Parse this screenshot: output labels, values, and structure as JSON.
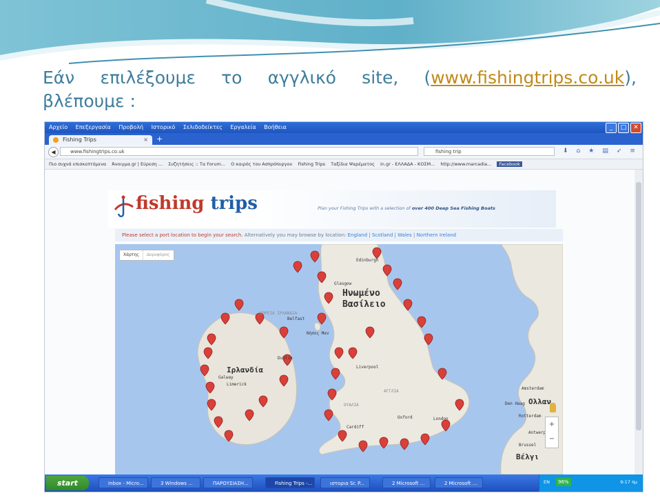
{
  "slide": {
    "heading_line1_a": "Εάν",
    "heading_line1_b": "επιλέξουμε",
    "heading_line1_c": "το",
    "heading_line1_d": "αγγλικό",
    "heading_line1_e": "site,",
    "heading_link": "www.fishingtrips.co.uk",
    "heading_line2": "βλέπουμε :",
    "accent_color": "#3e7d9b"
  },
  "browser": {
    "menu": [
      "Αρχείο",
      "Επεξεργασία",
      "Προβολή",
      "Ιστορικό",
      "Σελιδοδείκτες",
      "Εργαλεία",
      "Βοήθεια"
    ],
    "tab_title": "Fishing Trips",
    "url": "www.fishingtrips.co.uk",
    "search_value": "fishing trip",
    "bookmarks": [
      "Πιο συχνά επισκεπτόμενα",
      "Άνοιγμα.gr | Εύρεση ...",
      "Συζητήσεις :: Τα Forum...",
      "Ο καιρός του Ασπρόπυργου",
      "Fishing Trips",
      "Ταξίδια Ψαρέματος",
      "in.gr - ΕΛΛΑΔΑ - ΚΟΣΜ...",
      "http://www.marcadia...",
      "Facebook"
    ]
  },
  "site": {
    "logo_part1": "fishing",
    "logo_part2": "trips",
    "tagline_start": "Plan your Fishing Trips with a selection of",
    "tagline_bold": "over 400 Deep Sea Fishing Boats",
    "select_prompt": "Please select a port location to begin your search.",
    "browse_text": "Alternatively you may browse by location:",
    "regions": [
      "England",
      "Scotland",
      "Wales",
      "Northern Ireland"
    ],
    "map_type": [
      "Χάρτης",
      "Δορυφόρος"
    ],
    "map_labels": [
      "Ηνωμένο",
      "Βασίλειο",
      "Ιρλανδία",
      "Νήσος Μαν",
      "ΒΟΡΕΙΑ ΙΡΛΑΝΔΙΑ",
      "ΟΥΑΛΙΑ",
      "ΑΓΓΛΙΑ",
      "Liverpool",
      "Glasgow",
      "Edinburgh",
      "Galway",
      "Limerick",
      "Den Haag",
      "Ολλαν",
      "Amsterdam",
      "Rotterdam",
      "Brussel",
      "Βέλγι",
      "London",
      "Oxford",
      "Cardiff",
      "Dublin",
      "Belfast",
      "Antwerpen"
    ]
  },
  "taskbar": {
    "start": "start",
    "items": [
      "Inbox - Micro...",
      "3 Windows ...",
      "ΠΑΡΟΥΣΙΑΣΗ...",
      "Fishing Trips -...",
      "ιστορια Sr. P...",
      "2 Microsoft ...",
      "2 Microsoft ..."
    ],
    "lang": "EN",
    "battery": "96%",
    "clock": "9:17 πμ"
  }
}
